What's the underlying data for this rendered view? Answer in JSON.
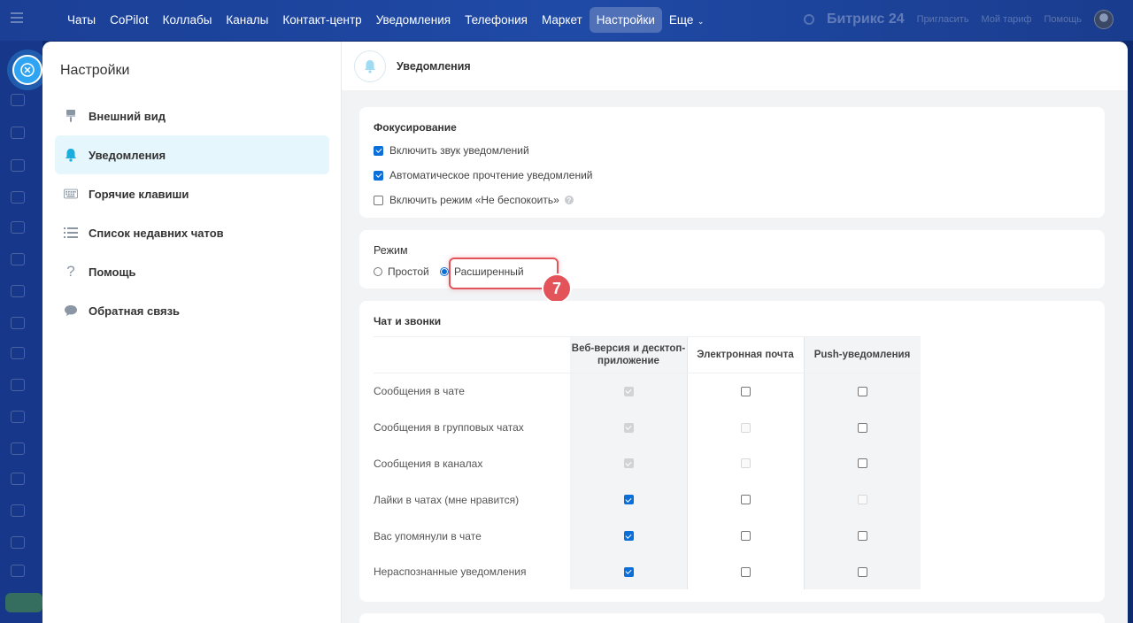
{
  "topbar": {
    "nav": [
      "Чаты",
      "CoPilot",
      "Коллабы",
      "Каналы",
      "Контакт-центр",
      "Уведомления",
      "Телефония",
      "Маркет",
      "Настройки",
      "Еще"
    ],
    "active": "Настройки",
    "right": {
      "brand": "Битрикс 24",
      "invite": "Пригласить",
      "tariff": "Мой тариф",
      "help": "Помощь"
    }
  },
  "settings": {
    "title": "Настройки",
    "menu": [
      {
        "label": "Внешний вид",
        "icon": "brush-icon"
      },
      {
        "label": "Уведомления",
        "icon": "bell-icon",
        "active": true
      },
      {
        "label": "Горячие клавиши",
        "icon": "keyboard-icon"
      },
      {
        "label": "Список недавних чатов",
        "icon": "list-icon"
      },
      {
        "label": "Помощь",
        "icon": "question-icon"
      },
      {
        "label": "Обратная связь",
        "icon": "chat-bubble-icon"
      }
    ]
  },
  "page": {
    "title": "Уведомления"
  },
  "focus": {
    "title": "Фокусирование",
    "options": [
      {
        "label": "Включить звук уведомлений",
        "checked": true
      },
      {
        "label": "Автоматическое прочтение уведомлений",
        "checked": true
      },
      {
        "label": "Включить режим «Не беспокоить»",
        "checked": false
      }
    ]
  },
  "mode": {
    "title": "Режим",
    "options": [
      "Простой",
      "Расширенный"
    ],
    "selected": "Расширенный",
    "step_badge": "7"
  },
  "chat_calls": {
    "title": "Чат и звонки",
    "columns": [
      "Веб-версия и десктоп-приложение",
      "Электронная почта",
      "Push-уведомления"
    ],
    "rows": [
      {
        "label": "Сообщения в чате",
        "states": [
          "disabled-checked",
          "unchecked",
          "unchecked"
        ]
      },
      {
        "label": "Сообщения в групповых чатах",
        "states": [
          "disabled-checked",
          "disabled",
          "unchecked"
        ]
      },
      {
        "label": "Сообщения в каналах",
        "states": [
          "disabled-checked",
          "disabled",
          "unchecked"
        ]
      },
      {
        "label": "Лайки в чатах (мне нравится)",
        "states": [
          "checked",
          "unchecked",
          "disabled"
        ]
      },
      {
        "label": "Вас упомянули в чате",
        "states": [
          "checked",
          "unchecked",
          "unchecked"
        ]
      },
      {
        "label": "Нераспознанные уведомления",
        "states": [
          "checked",
          "unchecked",
          "unchecked"
        ]
      }
    ]
  },
  "colors": {
    "accent": "#0a6fd8",
    "highlight": "#e2545a",
    "topbar": "#1f4aa6",
    "active_menu": "#e5f6fc"
  }
}
